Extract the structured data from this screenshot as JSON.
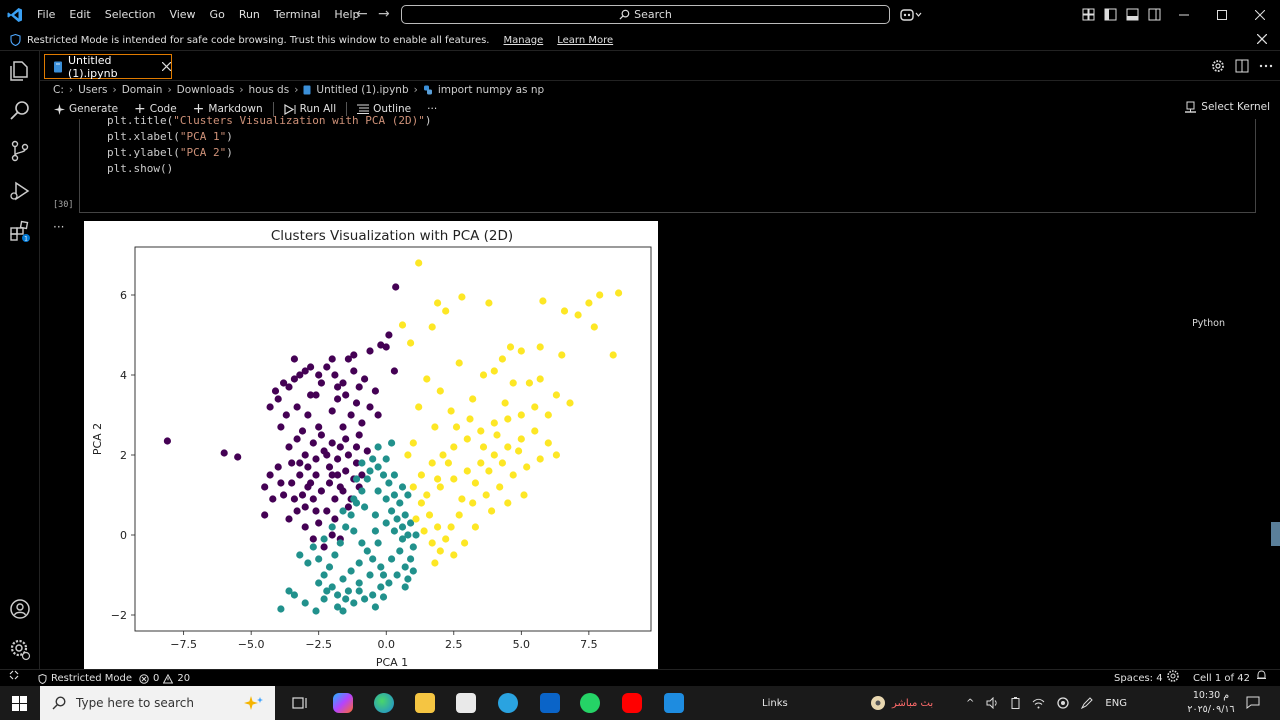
{
  "menu": [
    "File",
    "Edit",
    "Selection",
    "View",
    "Go",
    "Run",
    "Terminal",
    "Help"
  ],
  "search": {
    "label": "Search"
  },
  "banner": {
    "text": "Restricted Mode is intended for safe code browsing. Trust this window to enable all features.",
    "manage": "Manage",
    "learn_more": "Learn More"
  },
  "tab": {
    "label": "Untitled (1).ipynb"
  },
  "breadcrumb": [
    "C:",
    "Users",
    "Domain",
    "Downloads",
    "hous ds",
    "Untitled (1).ipynb",
    "import numpy as np"
  ],
  "toolbar": {
    "generate": "Generate",
    "code": "Code",
    "markdown": "Markdown",
    "run_all": "Run All",
    "outline": "Outline",
    "more": "···",
    "select_kernel": "Select Kernel"
  },
  "cell": {
    "lines": [
      {
        "pre": "plt.title(",
        "str": "\"Clusters Visualization with PCA (2D)\"",
        "post": ")"
      },
      {
        "pre": "plt.xlabel(",
        "str": "\"PCA 1\"",
        "post": ")"
      },
      {
        "pre": "plt.ylabel(",
        "str": "\"PCA 2\"",
        "post": ")"
      },
      {
        "pre": "plt.show()",
        "str": "",
        "post": ""
      }
    ],
    "exec_count": "[30]",
    "language": "Python",
    "output_dots": "···"
  },
  "chart_data": {
    "type": "scatter",
    "title": "Clusters Visualization with PCA (2D)",
    "xlabel": "PCA 1",
    "ylabel": "PCA 2",
    "xlim": [
      -9.3,
      9.8
    ],
    "ylim": [
      -2.4,
      7.2
    ],
    "xticks": [
      -7.5,
      -5.0,
      -2.5,
      0.0,
      2.5,
      5.0,
      7.5
    ],
    "xtick_labels": [
      "−7.5",
      "−5.0",
      "−2.5",
      "0.0",
      "2.5",
      "5.0",
      "7.5"
    ],
    "yticks": [
      -2,
      0,
      2,
      4,
      6
    ],
    "ytick_labels": [
      "−2",
      "0",
      "2",
      "4",
      "6"
    ],
    "grid": false,
    "series": [
      {
        "color": "#440154",
        "points": [
          [
            -8.1,
            2.35
          ],
          [
            -6.0,
            2.05
          ],
          [
            -5.5,
            1.95
          ],
          [
            -4.1,
            3.6
          ],
          [
            -4.0,
            3.4
          ],
          [
            -3.8,
            3.8
          ],
          [
            -3.6,
            3.7
          ],
          [
            -3.4,
            3.9
          ],
          [
            -3.2,
            4.0
          ],
          [
            -3.0,
            4.1
          ],
          [
            -2.8,
            4.2
          ],
          [
            -2.6,
            3.5
          ],
          [
            -3.3,
            3.2
          ],
          [
            -3.7,
            3.0
          ],
          [
            -2.9,
            3.0
          ],
          [
            -3.1,
            2.6
          ],
          [
            -2.4,
            3.8
          ],
          [
            -2.2,
            4.2
          ],
          [
            -1.9,
            4.0
          ],
          [
            -1.6,
            3.8
          ],
          [
            -1.4,
            4.4
          ],
          [
            -1.2,
            4.1
          ],
          [
            -1.0,
            3.7
          ],
          [
            -0.8,
            3.9
          ],
          [
            -1.2,
            4.5
          ],
          [
            -1.5,
            3.5
          ],
          [
            -1.8,
            3.4
          ],
          [
            -2.0,
            3.1
          ],
          [
            -1.3,
            3.0
          ],
          [
            -0.9,
            2.8
          ],
          [
            -1.0,
            2.5
          ],
          [
            -1.6,
            2.7
          ],
          [
            -2.5,
            2.7
          ],
          [
            -2.7,
            2.3
          ],
          [
            -3.0,
            2.0
          ],
          [
            -3.5,
            1.8
          ],
          [
            -4.0,
            1.7
          ],
          [
            -4.3,
            1.5
          ],
          [
            -4.5,
            1.2
          ],
          [
            -4.2,
            0.9
          ],
          [
            -3.8,
            1.0
          ],
          [
            -3.5,
            1.3
          ],
          [
            -3.2,
            1.5
          ],
          [
            -2.9,
            1.7
          ],
          [
            -2.6,
            1.9
          ],
          [
            -2.3,
            2.1
          ],
          [
            -2.0,
            2.3
          ],
          [
            -1.7,
            2.2
          ],
          [
            -1.4,
            2.0
          ],
          [
            -1.1,
            1.8
          ],
          [
            -0.9,
            1.5
          ],
          [
            -1.2,
            1.4
          ],
          [
            -1.5,
            1.6
          ],
          [
            -1.8,
            1.5
          ],
          [
            -2.1,
            1.3
          ],
          [
            -2.4,
            1.1
          ],
          [
            -2.7,
            0.9
          ],
          [
            -3.0,
            0.7
          ],
          [
            -3.3,
            0.6
          ],
          [
            -3.6,
            0.4
          ],
          [
            -4.5,
            0.5
          ],
          [
            -2.5,
            0.3
          ],
          [
            -2.2,
            0.6
          ],
          [
            -1.9,
            0.9
          ],
          [
            -1.6,
            1.1
          ],
          [
            -1.3,
            0.9
          ],
          [
            -1.0,
            1.2
          ],
          [
            -2.0,
            0.0
          ],
          [
            -2.3,
            -0.3
          ],
          [
            -1.7,
            -0.1
          ],
          [
            -3.0,
            0.2
          ],
          [
            -2.8,
            1.3
          ],
          [
            -3.1,
            1.0
          ],
          [
            -3.4,
            0.9
          ],
          [
            -2.6,
            1.5
          ],
          [
            -2.1,
            1.7
          ],
          [
            -1.8,
            1.9
          ],
          [
            -1.5,
            2.4
          ],
          [
            -1.1,
            2.2
          ],
          [
            -0.7,
            2.1
          ],
          [
            -0.6,
            4.6
          ],
          [
            -0.2,
            4.75
          ],
          [
            0.0,
            4.7
          ],
          [
            0.3,
            4.1
          ],
          [
            0.35,
            6.2
          ],
          [
            0.1,
            5.0
          ],
          [
            -0.4,
            3.6
          ],
          [
            -0.3,
            3.0
          ],
          [
            -2.4,
            2.5
          ],
          [
            -2.2,
            2.0
          ],
          [
            -2.0,
            1.5
          ],
          [
            -1.7,
            1.2
          ],
          [
            -1.4,
            0.7
          ],
          [
            -2.6,
            0.6
          ],
          [
            -2.9,
            1.2
          ],
          [
            -3.2,
            1.8
          ],
          [
            -3.3,
            2.4
          ],
          [
            -3.6,
            2.2
          ],
          [
            -3.9,
            2.7
          ],
          [
            -4.3,
            3.2
          ],
          [
            -2.8,
            3.5
          ],
          [
            -2.5,
            4.0
          ],
          [
            -3.4,
            4.4
          ],
          [
            -2.0,
            4.4
          ],
          [
            -1.8,
            3.7
          ],
          [
            -1.1,
            3.3
          ],
          [
            -0.6,
            3.2
          ],
          [
            -2.7,
            -0.1
          ],
          [
            -3.9,
            1.3
          ],
          [
            -1.9,
            0.4
          ]
        ]
      },
      {
        "color": "#21918c",
        "points": [
          [
            -3.9,
            -1.85
          ],
          [
            -3.6,
            -1.4
          ],
          [
            -3.4,
            -1.5
          ],
          [
            -3.0,
            -1.7
          ],
          [
            -2.6,
            -1.9
          ],
          [
            -2.3,
            -1.6
          ],
          [
            -2.0,
            -1.3
          ],
          [
            -1.8,
            -1.8
          ],
          [
            -1.5,
            -1.6
          ],
          [
            -1.2,
            -1.7
          ],
          [
            -1.0,
            -1.4
          ],
          [
            -0.8,
            -1.6
          ],
          [
            -0.5,
            -1.5
          ],
          [
            -0.2,
            -1.3
          ],
          [
            0.1,
            -1.2
          ],
          [
            0.4,
            -1.0
          ],
          [
            0.7,
            -0.8
          ],
          [
            0.9,
            -0.6
          ],
          [
            1.0,
            -0.3
          ],
          [
            1.1,
            0.0
          ],
          [
            0.9,
            0.3
          ],
          [
            0.7,
            0.5
          ],
          [
            0.5,
            0.8
          ],
          [
            0.3,
            1.0
          ],
          [
            0.1,
            1.3
          ],
          [
            -0.1,
            1.5
          ],
          [
            -0.3,
            1.7
          ],
          [
            -0.5,
            1.9
          ],
          [
            -0.7,
            1.4
          ],
          [
            -0.9,
            1.1
          ],
          [
            -1.1,
            0.8
          ],
          [
            -1.3,
            0.5
          ],
          [
            -1.5,
            0.2
          ],
          [
            -1.7,
            -0.2
          ],
          [
            -1.9,
            -0.5
          ],
          [
            -2.1,
            -0.8
          ],
          [
            -2.3,
            -1.0
          ],
          [
            -2.5,
            -0.6
          ],
          [
            -2.7,
            -0.3
          ],
          [
            -2.3,
            -0.1
          ],
          [
            -2.0,
            0.2
          ],
          [
            -1.6,
            0.6
          ],
          [
            -1.2,
            0.9
          ],
          [
            -0.8,
            0.7
          ],
          [
            -0.4,
            0.5
          ],
          [
            0.0,
            0.3
          ],
          [
            0.3,
            0.1
          ],
          [
            0.6,
            -0.1
          ],
          [
            -0.3,
            -0.2
          ],
          [
            -0.7,
            -0.4
          ],
          [
            -1.0,
            -0.7
          ],
          [
            -1.3,
            -0.9
          ],
          [
            -1.6,
            -1.1
          ],
          [
            -0.6,
            -1.0
          ],
          [
            -0.2,
            -0.8
          ],
          [
            0.2,
            -0.6
          ],
          [
            0.5,
            -0.4
          ],
          [
            -0.1,
            -1.0
          ],
          [
            -0.5,
            -0.6
          ],
          [
            -0.9,
            -0.2
          ],
          [
            -1.2,
            0.1
          ],
          [
            -0.4,
            0.1
          ],
          [
            0.2,
            0.6
          ],
          [
            0.4,
            0.4
          ],
          [
            0.6,
            0.2
          ],
          [
            0.8,
            0.0
          ],
          [
            -1.0,
            -1.2
          ],
          [
            -1.4,
            -1.4
          ],
          [
            -1.8,
            -1.5
          ],
          [
            -2.2,
            -1.4
          ],
          [
            -0.3,
            1.1
          ],
          [
            0.0,
            0.9
          ],
          [
            0.3,
            1.5
          ],
          [
            0.6,
            1.2
          ],
          [
            0.8,
            1.0
          ],
          [
            -0.6,
            1.6
          ],
          [
            0.0,
            1.9
          ],
          [
            -0.3,
            2.2
          ],
          [
            0.2,
            2.3
          ],
          [
            -0.9,
            1.8
          ],
          [
            -1.1,
            1.4
          ],
          [
            -2.9,
            -0.7
          ],
          [
            -3.2,
            -0.5
          ],
          [
            -2.5,
            -1.2
          ],
          [
            0.8,
            -1.1
          ],
          [
            1.0,
            -0.9
          ],
          [
            0.7,
            -1.3
          ],
          [
            -0.1,
            -1.55
          ],
          [
            -0.4,
            -1.8
          ],
          [
            -1.6,
            -1.9
          ]
        ]
      },
      {
        "color": "#fde725",
        "points": [
          [
            1.2,
            6.8
          ],
          [
            2.8,
            5.95
          ],
          [
            2.2,
            5.6
          ],
          [
            1.9,
            5.8
          ],
          [
            1.7,
            5.2
          ],
          [
            3.8,
            5.8
          ],
          [
            5.8,
            5.85
          ],
          [
            6.6,
            5.6
          ],
          [
            7.5,
            5.8
          ],
          [
            7.9,
            6.0
          ],
          [
            8.6,
            6.05
          ],
          [
            8.4,
            4.5
          ],
          [
            7.7,
            5.2
          ],
          [
            7.1,
            5.5
          ],
          [
            6.5,
            4.5
          ],
          [
            5.7,
            4.7
          ],
          [
            5.0,
            4.6
          ],
          [
            4.6,
            4.7
          ],
          [
            4.3,
            4.4
          ],
          [
            4.0,
            4.1
          ],
          [
            4.7,
            3.8
          ],
          [
            5.3,
            3.8
          ],
          [
            5.7,
            3.9
          ],
          [
            6.3,
            3.5
          ],
          [
            6.8,
            3.3
          ],
          [
            5.5,
            3.2
          ],
          [
            5.0,
            3.0
          ],
          [
            4.5,
            2.9
          ],
          [
            4.0,
            2.8
          ],
          [
            3.5,
            2.6
          ],
          [
            3.0,
            2.4
          ],
          [
            2.5,
            2.2
          ],
          [
            2.1,
            2.0
          ],
          [
            1.7,
            1.8
          ],
          [
            1.3,
            1.5
          ],
          [
            1.0,
            1.2
          ],
          [
            1.3,
            0.8
          ],
          [
            1.6,
            0.5
          ],
          [
            1.9,
            0.2
          ],
          [
            2.2,
            -0.1
          ],
          [
            2.0,
            -0.4
          ],
          [
            1.7,
            -0.2
          ],
          [
            1.4,
            0.1
          ],
          [
            1.1,
            0.4
          ],
          [
            1.5,
            1.0
          ],
          [
            2.0,
            1.2
          ],
          [
            2.5,
            1.4
          ],
          [
            3.0,
            1.6
          ],
          [
            3.5,
            1.8
          ],
          [
            4.0,
            2.0
          ],
          [
            4.5,
            2.2
          ],
          [
            5.0,
            2.4
          ],
          [
            5.5,
            2.6
          ],
          [
            6.0,
            2.3
          ],
          [
            6.3,
            2.0
          ],
          [
            5.7,
            1.9
          ],
          [
            5.2,
            1.7
          ],
          [
            4.7,
            1.5
          ],
          [
            4.2,
            1.2
          ],
          [
            3.7,
            1.0
          ],
          [
            3.2,
            0.8
          ],
          [
            2.7,
            0.5
          ],
          [
            2.4,
            0.2
          ],
          [
            2.8,
            0.9
          ],
          [
            3.3,
            1.3
          ],
          [
            3.8,
            1.6
          ],
          [
            4.3,
            1.8
          ],
          [
            4.9,
            2.1
          ],
          [
            1.2,
            3.2
          ],
          [
            1.5,
            3.9
          ],
          [
            0.9,
            4.8
          ],
          [
            0.6,
            5.25
          ],
          [
            1.0,
            2.3
          ],
          [
            0.8,
            2.0
          ],
          [
            1.8,
            2.7
          ],
          [
            2.4,
            3.1
          ],
          [
            2.0,
            3.6
          ],
          [
            2.7,
            4.3
          ],
          [
            3.2,
            3.4
          ],
          [
            3.6,
            4.0
          ],
          [
            4.4,
            3.3
          ],
          [
            6.0,
            3.0
          ],
          [
            5.1,
            1.0
          ],
          [
            4.5,
            0.8
          ],
          [
            3.9,
            0.6
          ],
          [
            3.3,
            0.2
          ],
          [
            2.9,
            -0.2
          ],
          [
            2.5,
            -0.5
          ],
          [
            1.8,
            -0.7
          ],
          [
            3.6,
            2.2
          ],
          [
            4.1,
            2.5
          ],
          [
            2.3,
            1.8
          ],
          [
            1.9,
            1.4
          ],
          [
            2.6,
            2.7
          ],
          [
            3.1,
            2.9
          ]
        ]
      }
    ]
  },
  "statusbar": {
    "restricted": "Restricted Mode",
    "errors": "0",
    "warnings": "20",
    "spaces": "Spaces: 4",
    "cell_pos": "Cell 1 of 42"
  },
  "taskbar": {
    "search_placeholder": "Type here to search",
    "links": "Links",
    "live": "بث مباشر",
    "lang": "ENG",
    "time": "10:30 م",
    "date": "٢٠٢٥/٠٩/١٦"
  }
}
